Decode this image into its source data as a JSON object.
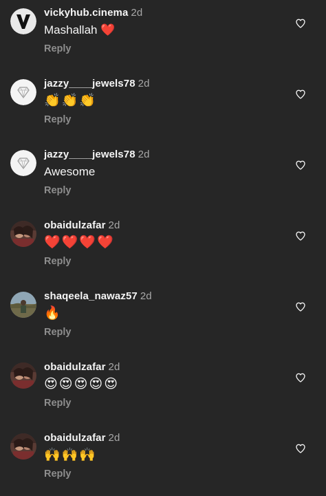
{
  "comments": [
    {
      "username": "vickyhub.cinema",
      "time": "2d",
      "text": "Mashallah ❤️",
      "reply": "Reply",
      "avatar": "v-logo-avatar"
    },
    {
      "username": "jazzy____jewels78",
      "time": "2d",
      "text": "👏👏👏",
      "reply": "Reply",
      "avatar": "diamond-logo-avatar"
    },
    {
      "username": "jazzy____jewels78",
      "time": "2d",
      "text": "Awesome",
      "reply": "Reply",
      "avatar": "diamond-logo-avatar"
    },
    {
      "username": "obaidulzafar",
      "time": "2d",
      "text": "❤️❤️❤️❤️",
      "reply": "Reply",
      "avatar": "couple-photo-avatar"
    },
    {
      "username": "shaqeela_nawaz57",
      "time": "2d",
      "text": "🔥",
      "reply": "Reply",
      "avatar": "outdoor-photo-avatar"
    },
    {
      "username": "obaidulzafar",
      "time": "2d",
      "text": "😍😍😍😍😍",
      "reply": "Reply",
      "avatar": "couple-photo-avatar"
    },
    {
      "username": "obaidulzafar",
      "time": "2d",
      "text": "🙌🙌🙌",
      "reply": "Reply",
      "avatar": "couple-photo-avatar"
    }
  ],
  "icons": {
    "like": "heart-outline-icon"
  },
  "colors": {
    "background": "#262626",
    "text": "#f5f5f5",
    "muted": "#8e8e8e",
    "time": "#a8a8a8"
  }
}
